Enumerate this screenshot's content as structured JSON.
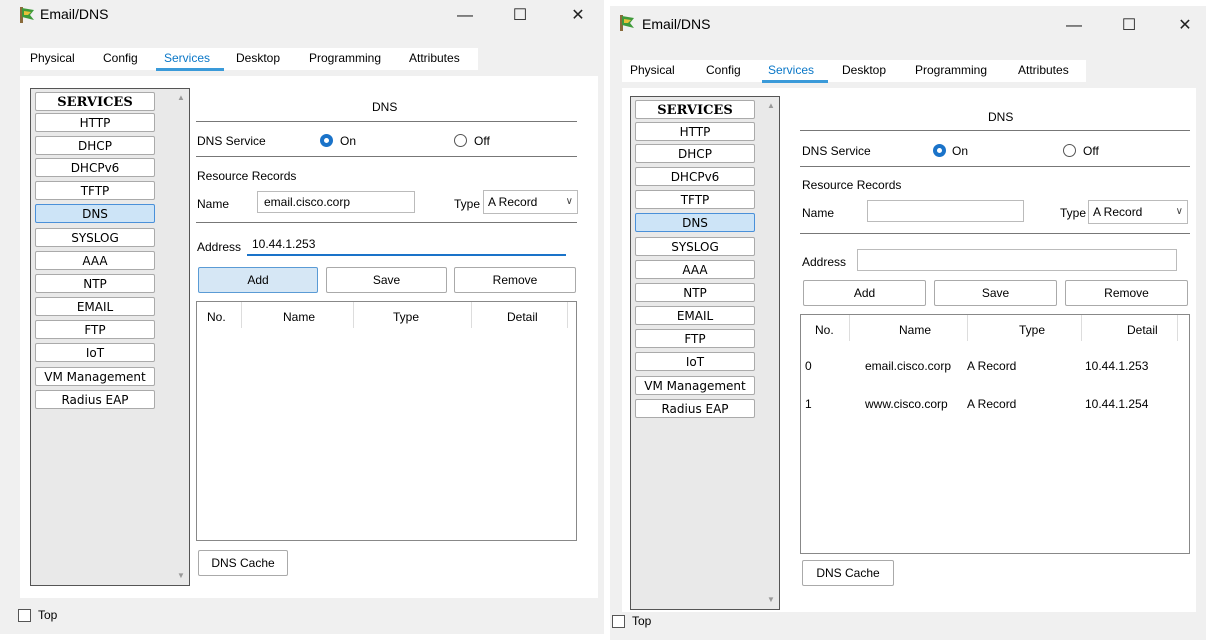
{
  "windows": [
    {
      "title": "Email/DNS",
      "controls": {
        "minimize": "—",
        "maximize": "☐",
        "close": "✕"
      },
      "tabs": [
        "Physical",
        "Config",
        "Services",
        "Desktop",
        "Programming",
        "Attributes"
      ],
      "active_tab": "Services",
      "services": [
        "SERVICES",
        "HTTP",
        "DHCP",
        "DHCPv6",
        "TFTP",
        "DNS",
        "SYSLOG",
        "AAA",
        "NTP",
        "EMAIL",
        "FTP",
        "IoT",
        "VM Management",
        "Radius EAP"
      ],
      "selected_service": "DNS",
      "dns": {
        "heading": "DNS",
        "service_label": "DNS Service",
        "on_label": "On",
        "off_label": "Off",
        "service_state": "On",
        "resource_records_label": "Resource Records",
        "name_label": "Name",
        "name_value": "email.cisco.corp",
        "type_label": "Type",
        "type_value": "A Record",
        "address_label": "Address",
        "address_value": "10.44.1.253",
        "add_label": "Add",
        "save_label": "Save",
        "remove_label": "Remove",
        "columns": [
          "No.",
          "Name",
          "Type",
          "Detail"
        ],
        "records": [],
        "cache_label": "DNS Cache"
      },
      "top_label": "Top"
    },
    {
      "title": "Email/DNS",
      "controls": {
        "minimize": "—",
        "maximize": "☐",
        "close": "✕"
      },
      "tabs": [
        "Physical",
        "Config",
        "Services",
        "Desktop",
        "Programming",
        "Attributes"
      ],
      "active_tab": "Services",
      "services": [
        "SERVICES",
        "HTTP",
        "DHCP",
        "DHCPv6",
        "TFTP",
        "DNS",
        "SYSLOG",
        "AAA",
        "NTP",
        "EMAIL",
        "FTP",
        "IoT",
        "VM Management",
        "Radius EAP"
      ],
      "selected_service": "DNS",
      "dns": {
        "heading": "DNS",
        "service_label": "DNS Service",
        "on_label": "On",
        "off_label": "Off",
        "service_state": "On",
        "resource_records_label": "Resource Records",
        "name_label": "Name",
        "name_value": "",
        "type_label": "Type",
        "type_value": "A Record",
        "address_label": "Address",
        "address_value": "",
        "add_label": "Add",
        "save_label": "Save",
        "remove_label": "Remove",
        "columns": [
          "No.",
          "Name",
          "Type",
          "Detail"
        ],
        "records": [
          {
            "no": "0",
            "name": "email.cisco.corp",
            "type": "A Record",
            "detail": "10.44.1.253"
          },
          {
            "no": "1",
            "name": "www.cisco.corp",
            "type": "A Record",
            "detail": "10.44.1.254"
          }
        ],
        "cache_label": "DNS Cache"
      },
      "top_label": "Top"
    }
  ]
}
